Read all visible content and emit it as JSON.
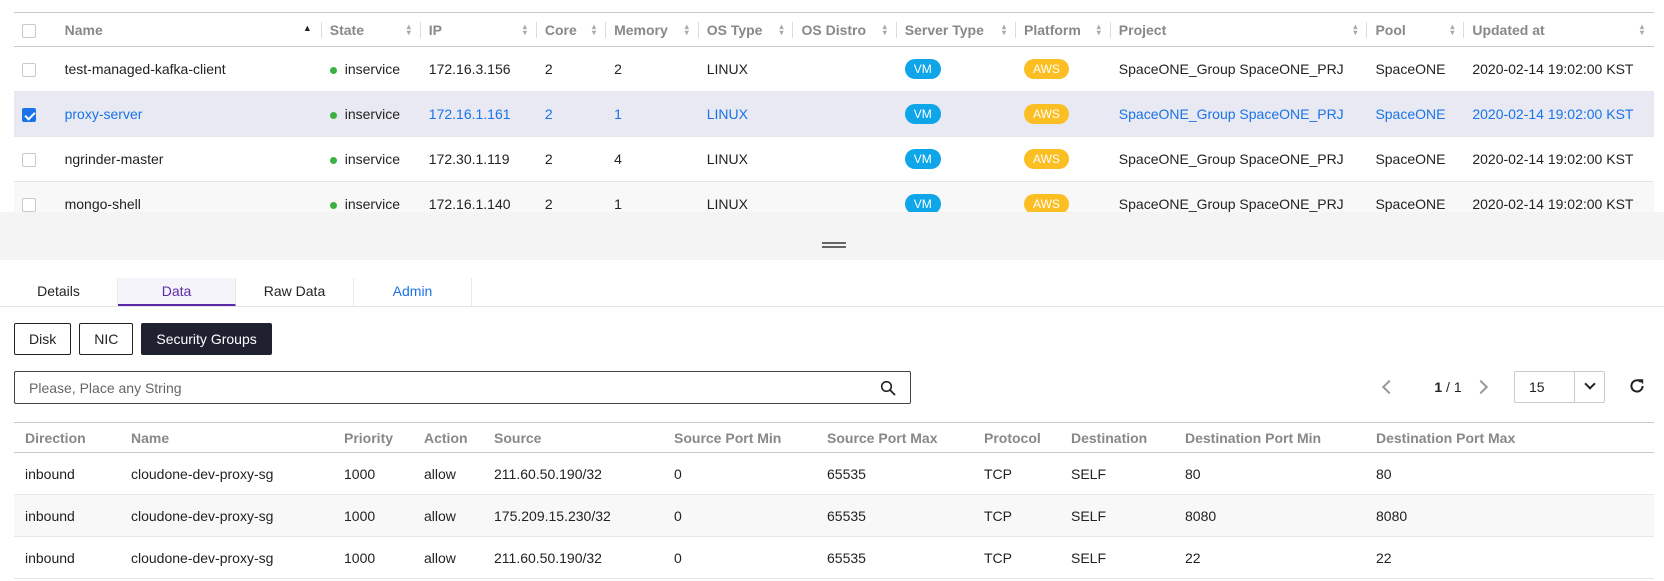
{
  "server_table": {
    "headers": {
      "name": "Name",
      "state": "State",
      "ip": "IP",
      "core": "Core",
      "memory": "Memory",
      "os_type": "OS Type",
      "os_distro": "OS Distro",
      "server_type": "Server Type",
      "platform": "Platform",
      "project": "Project",
      "pool": "Pool",
      "updated_at": "Updated at"
    },
    "rows": [
      {
        "name": "test-managed-kafka-client",
        "state": "inservice",
        "ip": "172.16.3.156",
        "core": "2",
        "memory": "2",
        "os_type": "LINUX",
        "server_type": "VM",
        "platform": "AWS",
        "project": "SpaceONE_Group SpaceONE_PRJ",
        "pool": "SpaceONE",
        "updated_at": "2020-02-14 19:02:00 KST",
        "selected": false
      },
      {
        "name": "proxy-server",
        "state": "inservice",
        "ip": "172.16.1.161",
        "core": "2",
        "memory": "1",
        "os_type": "LINUX",
        "server_type": "VM",
        "platform": "AWS",
        "project": "SpaceONE_Group SpaceONE_PRJ",
        "pool": "SpaceONE",
        "updated_at": "2020-02-14 19:02:00 KST",
        "selected": true
      },
      {
        "name": "ngrinder-master",
        "state": "inservice",
        "ip": "172.30.1.119",
        "core": "2",
        "memory": "4",
        "os_type": "LINUX",
        "server_type": "VM",
        "platform": "AWS",
        "project": "SpaceONE_Group SpaceONE_PRJ",
        "pool": "SpaceONE",
        "updated_at": "2020-02-14 19:02:00 KST",
        "selected": false
      },
      {
        "name": "mongo-shell",
        "state": "inservice",
        "ip": "172.16.1.140",
        "core": "2",
        "memory": "1",
        "os_type": "LINUX",
        "server_type": "VM",
        "platform": "AWS",
        "project": "SpaceONE_Group SpaceONE_PRJ",
        "pool": "SpaceONE",
        "updated_at": "2020-02-14 19:02:00 KST",
        "selected": false
      }
    ]
  },
  "tabs": [
    "Details",
    "Data",
    "Raw Data",
    "Admin"
  ],
  "sub_buttons": [
    "Disk",
    "NIC",
    "Security Groups"
  ],
  "search": {
    "placeholder": "Please, Place any String"
  },
  "pagination": {
    "current": "1",
    "total": "1",
    "page_size": "15"
  },
  "colors": {
    "accent_purple": "#5b2aa8",
    "link_blue": "#1a73e8",
    "vm_badge": "#0ea5e9",
    "aws_badge": "#fbbf24",
    "state_green": "#3cb043"
  },
  "sg_table": {
    "headers": [
      "Direction",
      "Name",
      "Priority",
      "Action",
      "Source",
      "Source Port Min",
      "Source Port Max",
      "Protocol",
      "Destination",
      "Destination Port Min",
      "Destination Port Max"
    ],
    "rows": [
      [
        "inbound",
        "cloudone-dev-proxy-sg",
        "1000",
        "allow",
        "211.60.50.190/32",
        "0",
        "65535",
        "TCP",
        "SELF",
        "80",
        "80"
      ],
      [
        "inbound",
        "cloudone-dev-proxy-sg",
        "1000",
        "allow",
        "175.209.15.230/32",
        "0",
        "65535",
        "TCP",
        "SELF",
        "8080",
        "8080"
      ],
      [
        "inbound",
        "cloudone-dev-proxy-sg",
        "1000",
        "allow",
        "211.60.50.190/32",
        "0",
        "65535",
        "TCP",
        "SELF",
        "22",
        "22"
      ]
    ]
  }
}
